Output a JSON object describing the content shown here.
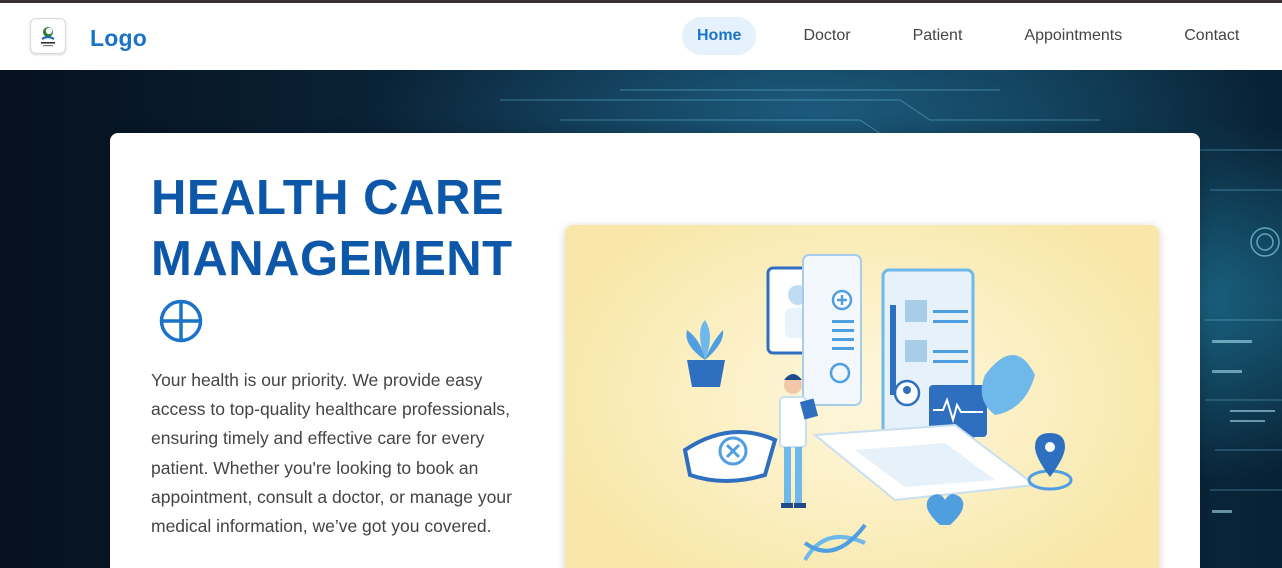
{
  "header": {
    "logo_text": "Logo",
    "nav": [
      {
        "label": "Home",
        "active": true
      },
      {
        "label": "Doctor",
        "active": false
      },
      {
        "label": "Patient",
        "active": false
      },
      {
        "label": "Appointments",
        "active": false
      },
      {
        "label": "Contact",
        "active": false
      }
    ]
  },
  "hero": {
    "title_line1": "HEALTH CARE",
    "title_line2": "MANAGEMENT",
    "icon": "medical-cross-circle-icon",
    "description": "Your health is our priority. We provide easy access to top-quality healthcare professionals, ensuring timely and effective care for every patient. Whether you're looking to book an appointment, consult a doctor, or manage your medical information, we’ve got you covered.",
    "illustration": "doctor-laptop-illustration"
  },
  "colors": {
    "brand_blue": "#1a73c8",
    "title_blue": "#0d57a8",
    "active_nav_bg": "#e5f1fc"
  }
}
